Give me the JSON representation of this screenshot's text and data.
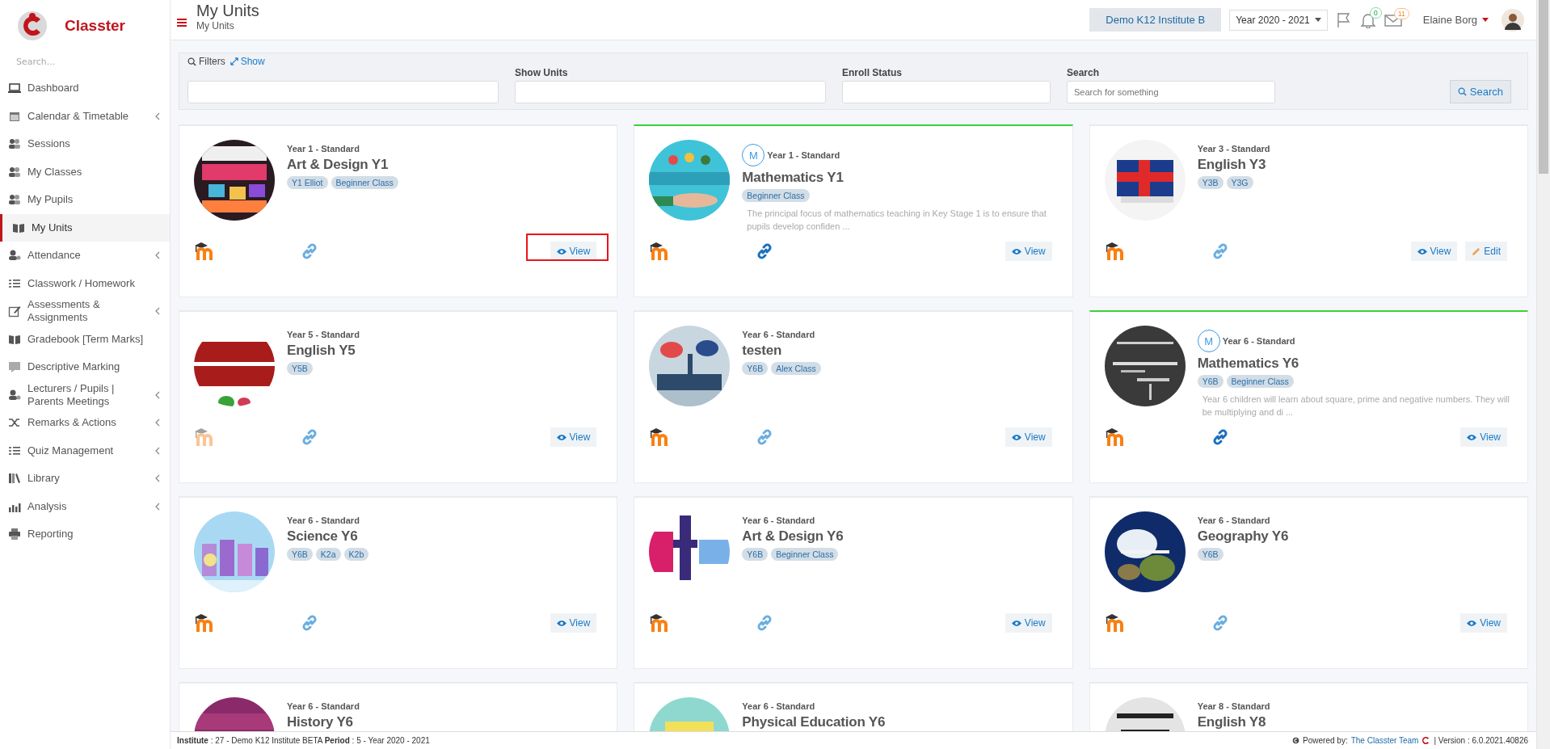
{
  "app": {
    "name": "Classter"
  },
  "sidebar": {
    "search_placeholder": "Search...",
    "items": [
      {
        "label": "Dashboard",
        "selected": false,
        "has_submenu": false
      },
      {
        "label": "Calendar & Timetable",
        "selected": false,
        "has_submenu": true
      },
      {
        "label": "Sessions",
        "selected": false,
        "has_submenu": false
      },
      {
        "label": "My Classes",
        "selected": false,
        "has_submenu": false
      },
      {
        "label": "My Pupils",
        "selected": false,
        "has_submenu": false
      },
      {
        "label": "My Units",
        "selected": true,
        "has_submenu": false
      },
      {
        "label": "Attendance",
        "selected": false,
        "has_submenu": true
      },
      {
        "label": "Classwork / Homework",
        "selected": false,
        "has_submenu": false
      },
      {
        "label": "Assessments & Assignments",
        "selected": false,
        "has_submenu": true
      },
      {
        "label": "Gradebook [Term Marks]",
        "selected": false,
        "has_submenu": false
      },
      {
        "label": "Descriptive Marking",
        "selected": false,
        "has_submenu": false
      },
      {
        "label": "Lecturers / Pupils | Parents Meetings",
        "selected": false,
        "has_submenu": true
      },
      {
        "label": "Remarks & Actions",
        "selected": false,
        "has_submenu": true
      },
      {
        "label": "Quiz Management",
        "selected": false,
        "has_submenu": true
      },
      {
        "label": "Library",
        "selected": false,
        "has_submenu": true
      },
      {
        "label": "Analysis",
        "selected": false,
        "has_submenu": true
      },
      {
        "label": "Reporting",
        "selected": false,
        "has_submenu": false
      }
    ]
  },
  "header": {
    "title": "My Units",
    "breadcrumb": "My Units",
    "institute": "Demo K12 Institute B",
    "year": "Year 2020 - 2021",
    "notifications": "0",
    "messages": "11",
    "user": "Elaine Borg"
  },
  "filters": {
    "title": "Filters",
    "toggle": "Show",
    "fields": [
      {
        "kind": "select"
      },
      {
        "kind": "select",
        "label": "Show Units"
      },
      {
        "kind": "select",
        "label": "Enroll Status"
      },
      {
        "kind": "text",
        "label": "Search",
        "placeholder": "Search for something"
      }
    ],
    "button": "Search"
  },
  "units": [
    {
      "level": "Year 1 - Standard",
      "title": "Art & Design Y1",
      "tags": [
        "Y1 Elliot",
        "Beginner Class"
      ],
      "featured": false,
      "moodle_faded": false,
      "highlighted": true,
      "buttons": [
        {
          "label": "View",
          "kind": "view"
        }
      ]
    },
    {
      "level": "Year 1 - Standard",
      "title": "Mathematics Y1",
      "badge": "M",
      "tags": [
        "Beginner Class"
      ],
      "description": "The principal focus of mathematics teaching in Key Stage 1 is to ensure that pupils develop confiden ...",
      "featured": true,
      "moodle_faded": false,
      "highlighted": false,
      "buttons": [
        {
          "label": "View",
          "kind": "view"
        }
      ]
    },
    {
      "level": "Year 3 - Standard",
      "title": "English Y3",
      "tags": [
        "Y3B",
        "Y3G"
      ],
      "featured": false,
      "moodle_faded": false,
      "highlighted": false,
      "buttons": [
        {
          "label": "View",
          "kind": "view"
        },
        {
          "label": "Edit",
          "kind": "edit"
        }
      ]
    },
    {
      "level": "Year 5 - Standard",
      "title": "English Y5",
      "tags": [
        "Y5B"
      ],
      "featured": false,
      "moodle_faded": true,
      "highlighted": false,
      "buttons": [
        {
          "label": "View",
          "kind": "view"
        }
      ]
    },
    {
      "level": "Year 6 - Standard",
      "title": "testen",
      "tags": [
        "Y6B",
        "Alex Class"
      ],
      "featured": false,
      "moodle_faded": false,
      "highlighted": false,
      "buttons": [
        {
          "label": "View",
          "kind": "view"
        }
      ]
    },
    {
      "level": "Year 6 - Standard",
      "title": "Mathematics Y6",
      "badge": "M",
      "tags": [
        "Y6B",
        "Beginner Class"
      ],
      "description": "Year 6 children will learn about square, prime and negative numbers. They will be multiplying and di ...",
      "featured": true,
      "moodle_faded": false,
      "highlighted": false,
      "buttons": [
        {
          "label": "View",
          "kind": "view"
        }
      ]
    },
    {
      "level": "Year 6 - Standard",
      "title": "Science Y6",
      "tags": [
        "Y6B",
        "K2a",
        "K2b"
      ],
      "featured": false,
      "moodle_faded": false,
      "highlighted": false,
      "buttons": [
        {
          "label": "View",
          "kind": "view"
        }
      ]
    },
    {
      "level": "Year 6 - Standard",
      "title": "Art & Design Y6",
      "tags": [
        "Y6B",
        "Beginner Class"
      ],
      "featured": false,
      "moodle_faded": false,
      "highlighted": false,
      "buttons": [
        {
          "label": "View",
          "kind": "view"
        }
      ]
    },
    {
      "level": "Year 6 - Standard",
      "title": "Geography Y6",
      "tags": [
        "Y6B"
      ],
      "featured": false,
      "moodle_faded": false,
      "highlighted": false,
      "buttons": [
        {
          "label": "View",
          "kind": "view"
        }
      ]
    },
    {
      "level": "Year 6 - Standard",
      "title": "History Y6",
      "featured": false
    },
    {
      "level": "Year 6 - Standard",
      "title": "Physical Education Y6",
      "featured": false
    },
    {
      "level": "Year 8 - Standard",
      "title": "English Y8",
      "featured": false
    }
  ],
  "footer": {
    "info": "**Institute** : 27 - Demo K12 Institute BETA **Period** : 5 - Year 2020 - 2021",
    "powered_by": "Powered by:",
    "team_link": "The Classter Team",
    "version": "| Version : 6.0.2021.40826"
  }
}
